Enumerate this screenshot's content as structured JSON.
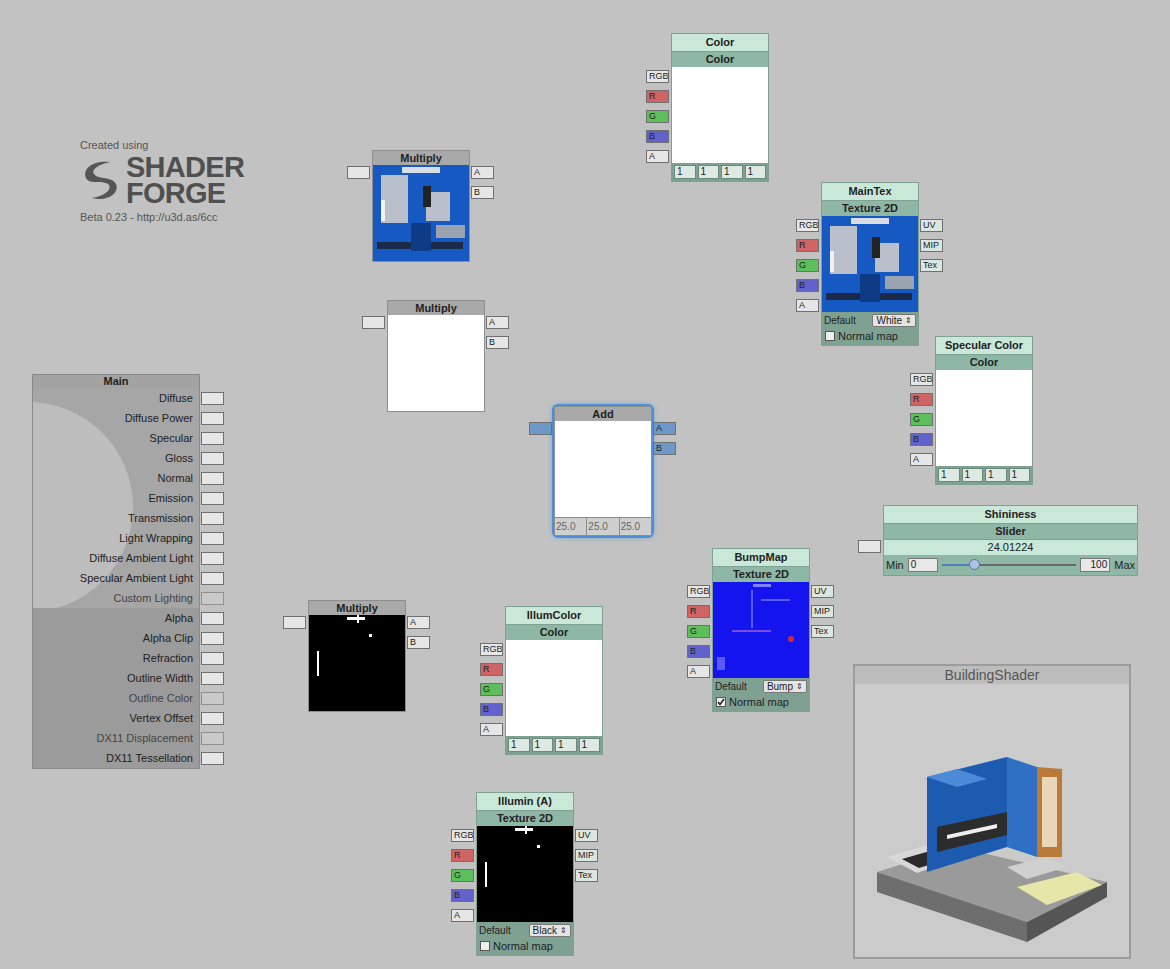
{
  "logo": {
    "caption": "Created using",
    "line1": "SHADER",
    "line2": "FORGE",
    "version": "Beta 0.23 - http://u3d.as/6cc"
  },
  "main": {
    "title": "Main",
    "ports": [
      {
        "label": "Diffuse",
        "enabled": true
      },
      {
        "label": "Diffuse Power",
        "enabled": true
      },
      {
        "label": "Specular",
        "enabled": true
      },
      {
        "label": "Gloss",
        "enabled": true
      },
      {
        "label": "Normal",
        "enabled": true
      },
      {
        "label": "Emission",
        "enabled": true
      },
      {
        "label": "Transmission",
        "enabled": true
      },
      {
        "label": "Light Wrapping",
        "enabled": true
      },
      {
        "label": "Diffuse Ambient Light",
        "enabled": true
      },
      {
        "label": "Specular Ambient Light",
        "enabled": true
      },
      {
        "label": "Custom Lighting",
        "enabled": false
      },
      {
        "label": "Alpha",
        "enabled": true
      },
      {
        "label": "Alpha Clip",
        "enabled": true
      },
      {
        "label": "Refraction",
        "enabled": true
      },
      {
        "label": "Outline Width",
        "enabled": true
      },
      {
        "label": "Outline Color",
        "enabled": false
      },
      {
        "label": "Vertex Offset",
        "enabled": true
      },
      {
        "label": "DX11 Displacement",
        "enabled": false
      },
      {
        "label": "DX11 Tessellation",
        "enabled": true
      }
    ]
  },
  "nodes": [
    {
      "kind": "operator",
      "title": "Multiply",
      "selected": false,
      "inputs": [
        {
          "label": "A"
        },
        {
          "label": "B"
        }
      ],
      "preview": {
        "kind": "albedo",
        "color": "#1659c2"
      }
    },
    {
      "kind": "operator",
      "title": "Multiply",
      "selected": false,
      "inputs": [
        {
          "label": "A"
        },
        {
          "label": "B"
        }
      ],
      "preview": {
        "kind": "solid",
        "color": "#ffffff"
      }
    },
    {
      "kind": "operator",
      "title": "Multiply",
      "selected": false,
      "inputs": [
        {
          "label": "A"
        },
        {
          "label": "B"
        }
      ],
      "preview": {
        "kind": "illum",
        "color": "#000000"
      }
    },
    {
      "kind": "operator",
      "title": "Add",
      "selected": true,
      "inputs": [
        {
          "label": "A"
        },
        {
          "label": "B"
        }
      ],
      "preview": {
        "kind": "solid",
        "color": "#ffffff"
      },
      "values": [
        "25.0",
        "25.0",
        "25.0"
      ]
    },
    {
      "kind": "color",
      "title": "Color",
      "subtitle": "Color",
      "selected": false,
      "outputs": [
        {
          "label": "RGB",
          "color": "#e6e6e6"
        },
        {
          "label": "R",
          "color": "#d06464"
        },
        {
          "label": "G",
          "color": "#5cbf5c"
        },
        {
          "label": "B",
          "color": "#6262cc"
        },
        {
          "label": "A",
          "color": "#e6e6e6"
        }
      ],
      "preview": {
        "kind": "solid",
        "color": "#ffffff"
      },
      "values": [
        "1",
        "1",
        "1",
        "1"
      ]
    },
    {
      "kind": "texture",
      "title": "MainTex",
      "subtitle": "Texture 2D",
      "selected": false,
      "outputs": [
        {
          "label": "RGB",
          "color": "#e6e6e6"
        },
        {
          "label": "R",
          "color": "#d06464"
        },
        {
          "label": "G",
          "color": "#5cbf5c"
        },
        {
          "label": "B",
          "color": "#6262cc"
        },
        {
          "label": "A",
          "color": "#e6e6e6"
        }
      ],
      "inputs": [
        {
          "label": "UV"
        },
        {
          "label": "MIP"
        },
        {
          "label": "Tex"
        }
      ],
      "preview": {
        "kind": "albedo",
        "color": "#1659c2"
      },
      "default_label": "Default",
      "default_value": "White",
      "dropdown_icon": "⇕",
      "normal_map_label": "Normal map",
      "normal_map": false
    },
    {
      "kind": "color",
      "title": "Specular Color",
      "subtitle": "Color",
      "selected": false,
      "outputs": [
        {
          "label": "RGB",
          "color": "#e6e6e6"
        },
        {
          "label": "R",
          "color": "#d06464"
        },
        {
          "label": "G",
          "color": "#5cbf5c"
        },
        {
          "label": "B",
          "color": "#6262cc"
        },
        {
          "label": "A",
          "color": "#e6e6e6"
        }
      ],
      "preview": {
        "kind": "solid",
        "color": "#ffffff"
      },
      "values": [
        "1",
        "1",
        "1",
        "1"
      ]
    },
    {
      "kind": "slider",
      "title": "Shininess",
      "subtitle": "Slider",
      "selected": false,
      "value": "24.01224",
      "min_label": "Min",
      "min": "0",
      "max": "100",
      "max_label": "Max",
      "level": 0.24
    },
    {
      "kind": "texture",
      "title": "BumpMap",
      "subtitle": "Texture 2D",
      "selected": false,
      "outputs": [
        {
          "label": "RGB",
          "color": "#e6e6e6"
        },
        {
          "label": "R",
          "color": "#d06464"
        },
        {
          "label": "G",
          "color": "#5cbf5c"
        },
        {
          "label": "B",
          "color": "#6262cc"
        },
        {
          "label": "A",
          "color": "#e6e6e6"
        }
      ],
      "inputs": [
        {
          "label": "UV"
        },
        {
          "label": "MIP"
        },
        {
          "label": "Tex"
        }
      ],
      "preview": {
        "kind": "normal",
        "color": "#1414ee"
      },
      "default_label": "Default",
      "default_value": "Bump",
      "dropdown_icon": "⇕",
      "normal_map_label": "Normal map",
      "normal_map": true
    },
    {
      "kind": "color",
      "title": "IllumColor",
      "subtitle": "Color",
      "selected": false,
      "outputs": [
        {
          "label": "RGB",
          "color": "#e6e6e6"
        },
        {
          "label": "R",
          "color": "#d06464"
        },
        {
          "label": "G",
          "color": "#5cbf5c"
        },
        {
          "label": "B",
          "color": "#6262cc"
        },
        {
          "label": "A",
          "color": "#e6e6e6"
        }
      ],
      "preview": {
        "kind": "solid",
        "color": "#ffffff"
      },
      "values": [
        "1",
        "1",
        "1",
        "1"
      ]
    },
    {
      "kind": "texture",
      "title": "Illumin (A)",
      "subtitle": "Texture 2D",
      "selected": false,
      "outputs": [
        {
          "label": "RGB",
          "color": "#e6e6e6"
        },
        {
          "label": "R",
          "color": "#d06464"
        },
        {
          "label": "G",
          "color": "#5cbf5c"
        },
        {
          "label": "B",
          "color": "#6262cc"
        },
        {
          "label": "A",
          "color": "#e6e6e6"
        }
      ],
      "inputs": [
        {
          "label": "UV"
        },
        {
          "label": "MIP"
        },
        {
          "label": "Tex"
        }
      ],
      "preview": {
        "kind": "illum",
        "color": "#000000"
      },
      "default_label": "Default",
      "default_value": "Black",
      "dropdown_icon": "⇕",
      "normal_map_label": "Normal map",
      "normal_map": false
    }
  ],
  "wires": [
    {
      "from": "main.ports.0",
      "to": "nodes.0.output",
      "kind": "rgb",
      "selected": false
    },
    {
      "from": "nodes.0.inputs.0",
      "to": "nodes.4.outputs.0",
      "kind": "rgb",
      "selected": false
    },
    {
      "from": "nodes.0.inputs.1",
      "to": "nodes.5.outputs.0",
      "kind": "rgb",
      "selected": false
    },
    {
      "from": "main.ports.11",
      "to": "nodes.1.output",
      "kind": "scalar",
      "selected": false
    },
    {
      "from": "nodes.1.inputs.0",
      "to": "nodes.5.outputs.4",
      "kind": "scalar",
      "selected": false
    },
    {
      "from": "nodes.1.inputs.1",
      "to": "nodes.4.outputs.4",
      "kind": "scalar",
      "selected": false
    },
    {
      "from": "main.ports.2",
      "to": "nodes.3.output",
      "kind": "rgb",
      "selected": true
    },
    {
      "from": "nodes.3.inputs.0",
      "to": "nodes.6.outputs.0",
      "kind": "rgb",
      "selected": true
    },
    {
      "from": "nodes.3.inputs.1",
      "to": "nodes.7.output",
      "kind": "scalar",
      "selected": true
    },
    {
      "from": "main.ports.4",
      "to": "nodes.8.outputs.0",
      "kind": "rgb",
      "selected": false
    },
    {
      "from": "main.ports.5",
      "to": "nodes.2.output",
      "kind": "rgb",
      "selected": false
    },
    {
      "from": "nodes.2.inputs.0",
      "to": "nodes.9.outputs.0",
      "kind": "rgb",
      "selected": false
    },
    {
      "from": "nodes.2.inputs.1",
      "to": "nodes.10.outputs.0",
      "kind": "rgb",
      "selected": false
    }
  ],
  "preview": {
    "title": "BuildingShader"
  }
}
